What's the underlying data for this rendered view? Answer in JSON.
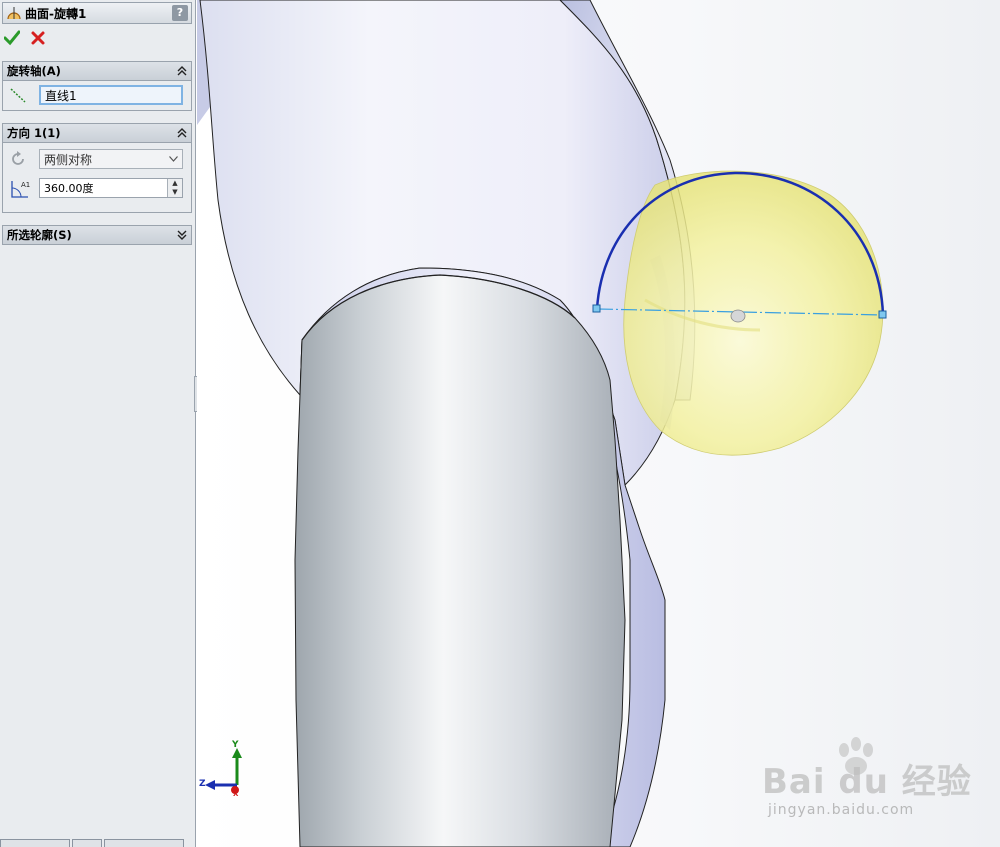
{
  "property_manager": {
    "title": "曲面-旋轉1",
    "help_label": "?",
    "axis_group": {
      "header": "旋转轴(A)",
      "axis_value": "直线1"
    },
    "direction_group": {
      "header": "方向 1(1)",
      "type_value": "两侧对称",
      "angle_value": "360.00度"
    },
    "profile_group": {
      "header": "所选轮廓(S)"
    }
  },
  "viewport": {
    "triad": {
      "y_label": "Y",
      "z_label": "Z",
      "x_label": "X"
    },
    "watermark": {
      "brand": "Bai du 经验",
      "url": "jingyan.baidu.com"
    }
  },
  "colors": {
    "ok_green": "#2a9a2a",
    "cancel_red": "#d62020",
    "arc_blue": "#1a2fb0",
    "axis_line": "#3aa0e0",
    "preview_yellow": "#f4f2a2"
  }
}
